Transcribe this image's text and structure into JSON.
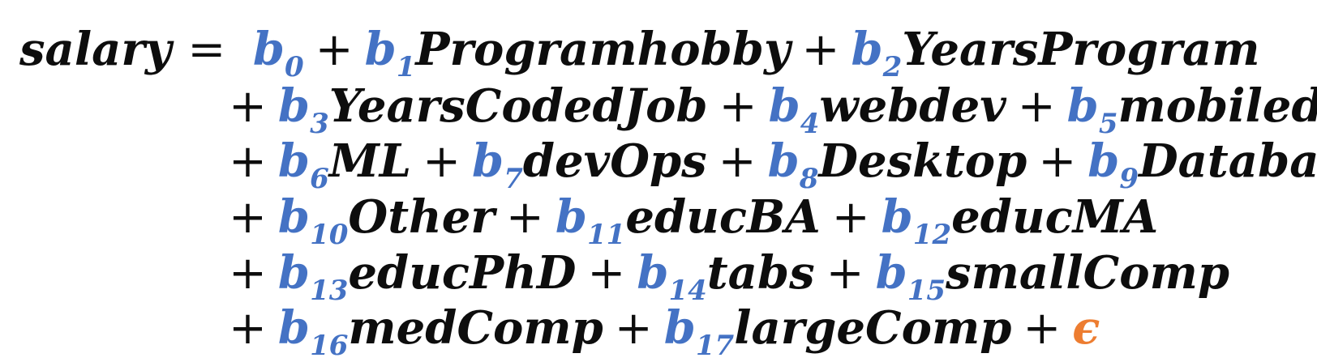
{
  "equation": {
    "lhs": "salary",
    "equals": "=",
    "plus": "+",
    "coefficient_letter": "b",
    "terms": [
      {
        "coef_sub": "0",
        "var": ""
      },
      {
        "coef_sub": "1",
        "var": "Programhobby"
      },
      {
        "coef_sub": "2",
        "var": "YearsProgram"
      },
      {
        "coef_sub": "3",
        "var": "YearsCodedJob"
      },
      {
        "coef_sub": "4",
        "var": "webdev"
      },
      {
        "coef_sub": "5",
        "var": "mobiledev"
      },
      {
        "coef_sub": "6",
        "var": "ML"
      },
      {
        "coef_sub": "7",
        "var": "devOps"
      },
      {
        "coef_sub": "8",
        "var": "Desktop"
      },
      {
        "coef_sub": "9",
        "var": "Database"
      },
      {
        "coef_sub": "10",
        "var": "Other"
      },
      {
        "coef_sub": "11",
        "var": "educBA"
      },
      {
        "coef_sub": "12",
        "var": "educMA"
      },
      {
        "coef_sub": "13",
        "var": "educPhD"
      },
      {
        "coef_sub": "14",
        "var": "tabs"
      },
      {
        "coef_sub": "15",
        "var": "smallComp"
      },
      {
        "coef_sub": "16",
        "var": "medComp"
      },
      {
        "coef_sub": "17",
        "var": "largeComp"
      }
    ],
    "error_term": "ϵ",
    "colors": {
      "text": "#0d0d0d",
      "coefficient": "#4472c4",
      "error_term": "#ed7d31"
    }
  }
}
